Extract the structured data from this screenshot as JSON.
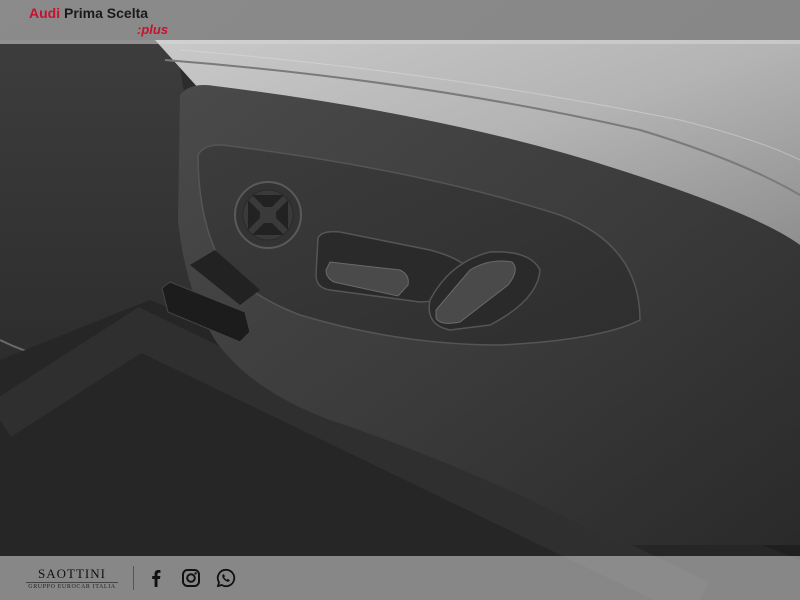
{
  "brand": {
    "audi": "Audi",
    "name": "Prima Scelta",
    "plus": ":plus",
    "accent_color": "#c4122f"
  },
  "dealer": {
    "name": "SAOTTINI",
    "group": "GRUPPO EUROCAR ITALIA"
  },
  "social": [
    {
      "icon": "facebook-icon"
    },
    {
      "icon": "instagram-icon"
    },
    {
      "icon": "whatsapp-icon"
    }
  ]
}
